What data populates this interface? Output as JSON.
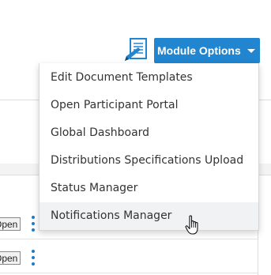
{
  "toolbar": {
    "doc_icon": "document-edit-icon",
    "module_options_label": "Module Options",
    "caret_icon": "caret-down-icon"
  },
  "menu": {
    "items": [
      {
        "label": "Edit Document Templates"
      },
      {
        "label": "Open Participant Portal"
      },
      {
        "label": "Global Dashboard"
      },
      {
        "label": "Distributions Specifications Upload"
      },
      {
        "label": "Status Manager"
      },
      {
        "label": "Notifications Manager",
        "hovered": true
      }
    ]
  },
  "table": {
    "rows": [
      {
        "action_label": "Open"
      },
      {
        "action_label": "Open"
      }
    ],
    "row_menu_icon": "kebab-menu-icon"
  },
  "cursor": "hand-pointer-icon",
  "colors": {
    "accent": "#2185d0",
    "kebab": "#1f7cc4",
    "menu_hover": "#f1f2f4"
  }
}
